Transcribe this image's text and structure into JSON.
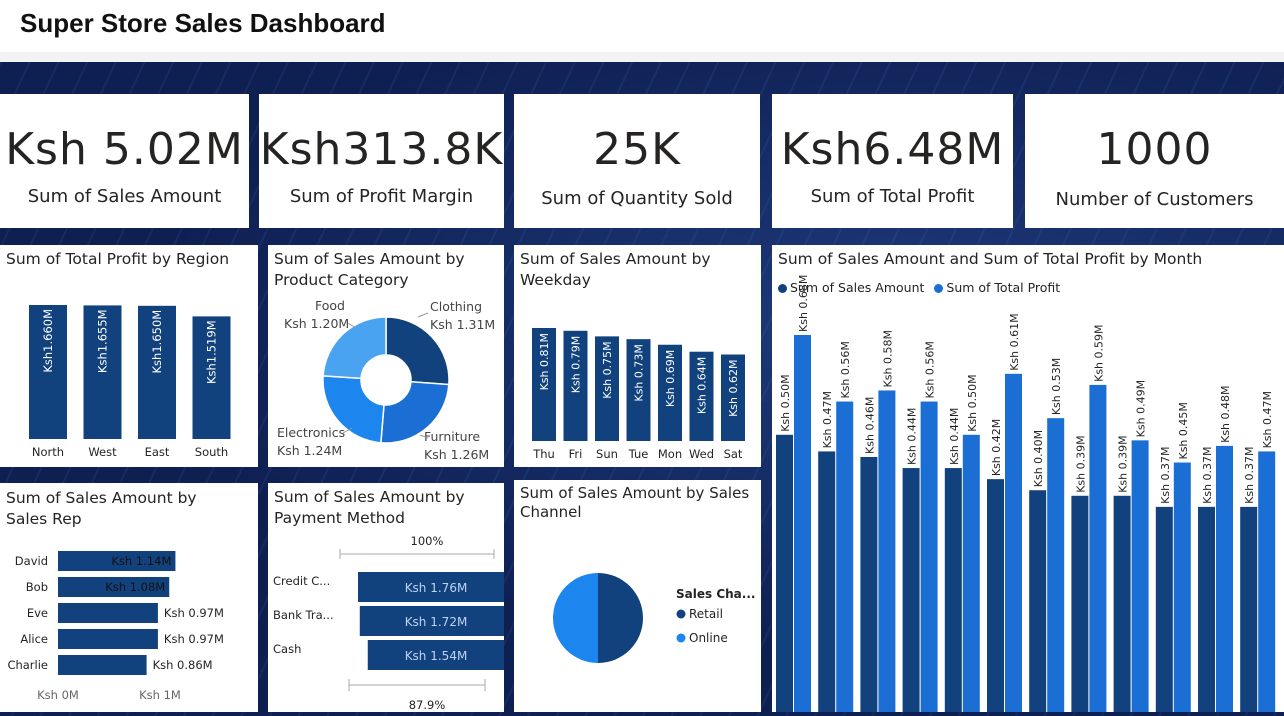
{
  "title": "Super Store Sales Dashboard",
  "colors": {
    "dark": "#12427e",
    "mid": "#1b6fd4",
    "light": "#4aa3f0"
  },
  "kpis": [
    {
      "value": "Ksh 5.02M",
      "label": "Sum of Sales Amount"
    },
    {
      "value": "Ksh313.8K",
      "label": "Sum of Profit Margin"
    },
    {
      "value": "25K",
      "label": "Sum of Quantity Sold"
    },
    {
      "value": "Ksh6.48M",
      "label": "Sum of Total Profit"
    },
    {
      "value": "1000",
      "label": "Number of Customers"
    }
  ],
  "region_chart": {
    "title": "Sum of Total Profit by Region",
    "chart_data": {
      "type": "bar",
      "categories": [
        "North",
        "West",
        "East",
        "South"
      ],
      "values": [
        1.66,
        1.655,
        1.65,
        1.519
      ],
      "labels": [
        "Ksh1.660M",
        "Ksh1.655M",
        "Ksh1.650M",
        "Ksh1.519M"
      ]
    }
  },
  "category_chart": {
    "title": "Sum of Sales Amount by Product Category",
    "chart_data": {
      "type": "pie",
      "categories": [
        "Clothing",
        "Furniture",
        "Electronics",
        "Food"
      ],
      "values": [
        1.31,
        1.26,
        1.24,
        1.2
      ],
      "labels": [
        "Ksh 1.31M",
        "Ksh 1.26M",
        "Ksh 1.24M",
        "Ksh 1.20M"
      ]
    }
  },
  "weekday_chart": {
    "title": "Sum of Sales Amount by Weekday",
    "chart_data": {
      "type": "bar",
      "categories": [
        "Thu",
        "Fri",
        "Sun",
        "Tue",
        "Mon",
        "Wed",
        "Sat"
      ],
      "values": [
        0.81,
        0.79,
        0.75,
        0.73,
        0.69,
        0.64,
        0.62
      ],
      "labels": [
        "Ksh 0.81M",
        "Ksh 0.79M",
        "Ksh 0.75M",
        "Ksh 0.73M",
        "Ksh 0.69M",
        "Ksh 0.64M",
        "Ksh 0.62M"
      ]
    }
  },
  "month_chart": {
    "title": "Sum of Sales Amount and Sum of Total Profit by Month",
    "chart_data": {
      "type": "bar",
      "series": [
        {
          "name": "Sum of Sales Amount",
          "values": [
            0.5,
            0.47,
            0.46,
            0.44,
            0.44,
            0.42,
            0.4,
            0.39,
            0.39,
            0.37,
            0.37,
            0.37
          ],
          "labels": [
            "Ksh 0.50M",
            "Ksh 0.47M",
            "Ksh 0.46M",
            "Ksh 0.44M",
            "Ksh 0.44M",
            "Ksh 0.42M",
            "Ksh 0.40M",
            "Ksh 0.39M",
            "Ksh 0.39M",
            "Ksh 0.37M",
            "Ksh 0.37M",
            "Ksh 0.37M"
          ]
        },
        {
          "name": "Sum of Total Profit",
          "values": [
            0.68,
            0.56,
            0.58,
            0.56,
            0.5,
            0.61,
            0.53,
            0.59,
            0.49,
            0.45,
            0.48,
            0.47
          ],
          "labels": [
            "Ksh 0.68M",
            "Ksh 0.56M",
            "Ksh 0.58M",
            "Ksh 0.56M",
            "Ksh 0.50M",
            "Ksh 0.61M",
            "Ksh 0.53M",
            "Ksh 0.59M",
            "Ksh 0.49M",
            "Ksh 0.45M",
            "Ksh 0.48M",
            "Ksh 0.47M"
          ]
        }
      ]
    }
  },
  "salesrep_chart": {
    "title": "Sum of Sales Amount by Sales Rep",
    "chart_data": {
      "type": "bar",
      "categories": [
        "David",
        "Bob",
        "Eve",
        "Alice",
        "Charlie"
      ],
      "values": [
        1.14,
        1.08,
        0.97,
        0.97,
        0.86
      ],
      "labels": [
        "Ksh 1.14M",
        "Ksh 1.08M",
        "Ksh 0.97M",
        "Ksh 0.97M",
        "Ksh 0.86M"
      ],
      "xticks": [
        "Ksh 0M",
        "Ksh 1M"
      ],
      "xlim": [
        0,
        1.5
      ]
    }
  },
  "payment_chart": {
    "title": "Sum of Sales Amount by Payment Method",
    "chart_data": {
      "type": "bar",
      "categories": [
        "Credit C...",
        "Bank Tra...",
        "Cash"
      ],
      "values": [
        1.76,
        1.72,
        1.54
      ],
      "labels": [
        "Ksh 1.76M",
        "Ksh 1.72M",
        "Ksh 1.54M"
      ],
      "top_pct": "100%",
      "bottom_pct": "87.9%"
    }
  },
  "channel_chart": {
    "title": "Sum of Sales Amount by Sales Channel",
    "legend_title": "Sales Cha...",
    "chart_data": {
      "type": "pie",
      "categories": [
        "Retail",
        "Online"
      ],
      "values": [
        0.5,
        0.5
      ]
    }
  }
}
